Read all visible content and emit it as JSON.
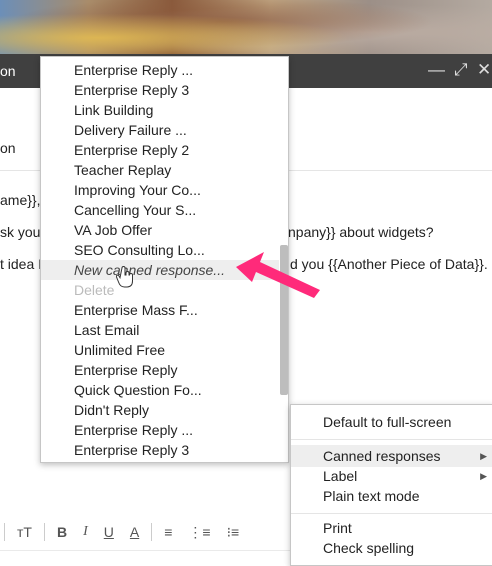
{
  "compose": {
    "title_fragment": "on",
    "minimize_icon": "minimize-icon",
    "expand_icon": "expand-icon",
    "close_icon": "close-icon",
    "subject_fragment": "on",
    "body_line1": "ame}},",
    "body_line2_left": "sk you",
    "body_line2_right": "npany}} about widgets?",
    "body_line3_left": "t idea I'",
    "body_line3_right": "d you {{Another Piece of Data}}."
  },
  "canned_menu": {
    "items": [
      {
        "label": "Enterprise Reply ..."
      },
      {
        "label": "Enterprise Reply 3"
      },
      {
        "label": "Link Building"
      },
      {
        "label": "Delivery Failure ..."
      },
      {
        "label": "Enterprise Reply 2"
      },
      {
        "label": "Teacher Replay"
      },
      {
        "label": "Improving Your Co..."
      },
      {
        "label": "Cancelling Your S..."
      },
      {
        "label": "VA Job Offer"
      },
      {
        "label": "SEO Consulting Lo..."
      },
      {
        "label": "New canned response..."
      },
      {
        "label": "Delete"
      },
      {
        "label": "Enterprise Mass F..."
      },
      {
        "label": "Last Email"
      },
      {
        "label": "Unlimited Free"
      },
      {
        "label": "Enterprise Reply"
      },
      {
        "label": "Quick Question Fo..."
      },
      {
        "label": "Didn't Reply"
      },
      {
        "label": "Enterprise Reply ..."
      },
      {
        "label": "Enterprise Reply 3"
      }
    ]
  },
  "options_menu": {
    "default_fullscreen": "Default to full-screen",
    "canned_responses": "Canned responses",
    "label": "Label",
    "plain_text_mode": "Plain text mode",
    "print": "Print",
    "check_spelling": "Check spelling"
  },
  "toolbar": {
    "font_size": "тT",
    "bold": "B",
    "italic": "I",
    "underline": "U",
    "text_color": "A",
    "align": "≡",
    "numbered_list": "⋮≡",
    "bulleted_list": "⁝≡"
  },
  "colors": {
    "header_bg": "#404040",
    "annotation_arrow": "#ff2a7a",
    "hover_bg": "#eeeeee",
    "disabled_text": "#bbbbbb"
  }
}
